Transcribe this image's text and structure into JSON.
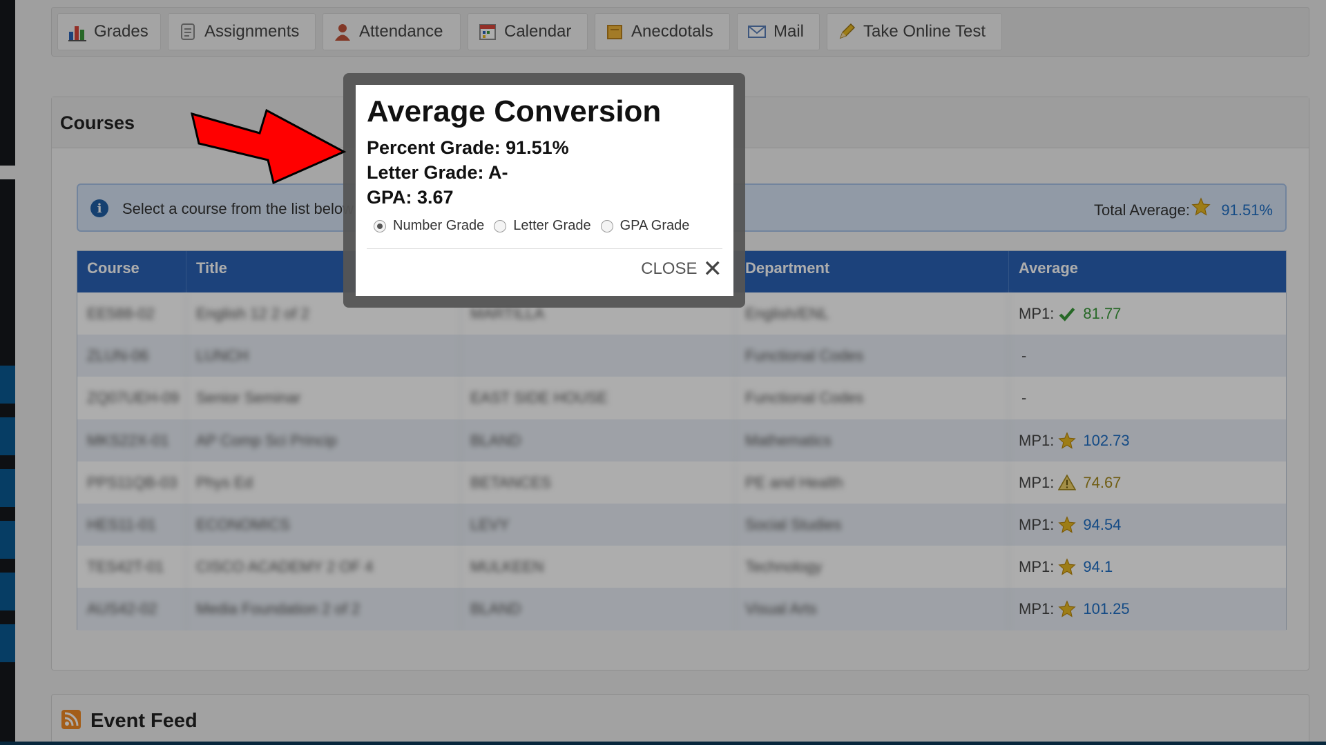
{
  "nav": {
    "tabs": [
      {
        "label": "Grades",
        "icon": "bar-chart-icon"
      },
      {
        "label": "Assignments",
        "icon": "assignment-icon"
      },
      {
        "label": "Attendance",
        "icon": "person-icon"
      },
      {
        "label": "Calendar",
        "icon": "calendar-icon"
      },
      {
        "label": "Anecdotals",
        "icon": "note-icon"
      },
      {
        "label": "Mail",
        "icon": "envelope-icon"
      },
      {
        "label": "Take Online Test",
        "icon": "pencil-icon"
      }
    ]
  },
  "courses": {
    "title": "Courses",
    "info_text": "Select a course from the list below",
    "total_label": "Total Average:",
    "total_value": "91.51%",
    "columns": [
      "Course",
      "Title",
      "",
      "Department",
      "Average"
    ],
    "rows": [
      {
        "course": "EE588-02",
        "title": "English 12 2 of 2",
        "teacher": "MARTILLA",
        "department": "English/ENL",
        "mp": "MP1:",
        "average": "81.77",
        "status": "check",
        "color": "#3a9a3a"
      },
      {
        "course": "ZLUN-06",
        "title": "LUNCH",
        "teacher": "",
        "department": "Functional Codes",
        "mp": "",
        "average": "-",
        "status": "none",
        "color": "#444444"
      },
      {
        "course": "ZQ07UEH-09",
        "title": "Senior Seminar",
        "teacher": "EAST SIDE HOUSE",
        "department": "Functional Codes",
        "mp": "",
        "average": "-",
        "status": "none",
        "color": "#444444"
      },
      {
        "course": "MKS22X-01",
        "title": "AP Comp Sci Princip",
        "teacher": "BLAND",
        "department": "Mathematics",
        "mp": "MP1:",
        "average": "102.73",
        "status": "star",
        "color": "#1f6fc5"
      },
      {
        "course": "PPS11QB-03",
        "title": "Phys Ed",
        "teacher": "BETANCES",
        "department": "PE and Health",
        "mp": "MP1:",
        "average": "74.67",
        "status": "warning",
        "color": "#a58a1c"
      },
      {
        "course": "HES11-01",
        "title": "ECONOMICS",
        "teacher": "LEVY",
        "department": "Social Studies",
        "mp": "MP1:",
        "average": "94.54",
        "status": "star",
        "color": "#1f6fc5"
      },
      {
        "course": "TES42T-01",
        "title": "CISCO ACADEMY 2 OF 4",
        "teacher": "MULKEEN",
        "department": "Technology",
        "mp": "MP1:",
        "average": "94.1",
        "status": "star",
        "color": "#1f6fc5"
      },
      {
        "course": "AUS42-02",
        "title": "Media Foundation 2 of 2",
        "teacher": "BLAND",
        "department": "Visual Arts",
        "mp": "MP1:",
        "average": "101.25",
        "status": "star",
        "color": "#1f6fc5"
      }
    ]
  },
  "event_feed": {
    "title": "Event Feed",
    "icon": "rss-icon"
  },
  "modal": {
    "title": "Average Conversion",
    "percent_line": "Percent Grade: 91.51%",
    "letter_line": "Letter Grade: A-",
    "gpa_line": "GPA: 3.67",
    "options": [
      {
        "label": "Number Grade",
        "selected": true
      },
      {
        "label": "Letter Grade",
        "selected": false
      },
      {
        "label": "GPA Grade",
        "selected": false
      }
    ],
    "close_label": "CLOSE"
  },
  "colors": {
    "header_blue": "#2a62b6",
    "link_blue": "#1f6fc5",
    "arrow_red": "#ff0000",
    "star_gold": "#e8b923"
  }
}
